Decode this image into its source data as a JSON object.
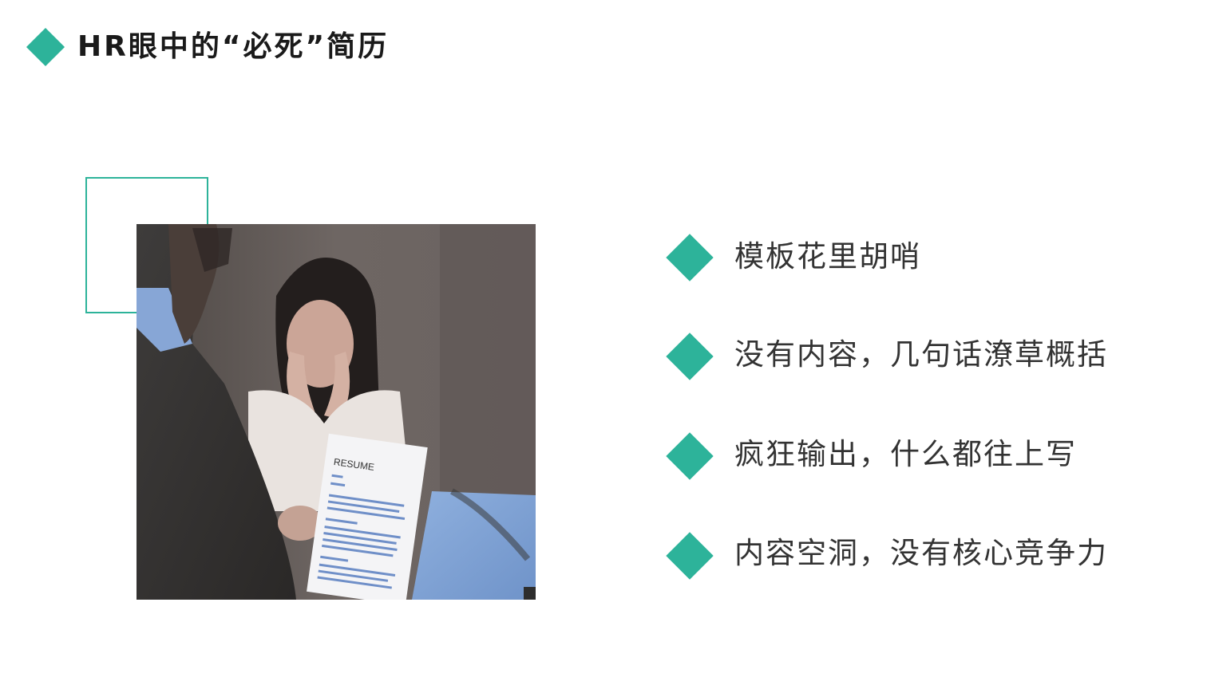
{
  "header": {
    "title": "HR眼中的“必死”简历"
  },
  "image": {
    "alt_description": "",
    "resume_label": "RESUME"
  },
  "bullets": [
    {
      "text": "模板花里胡哨"
    },
    {
      "text": "没有内容，几句话潦草概括"
    },
    {
      "text": "疯狂输出，什么都往上写"
    },
    {
      "text": "内容空洞，没有核心竞争力"
    }
  ],
  "colors": {
    "accent": "#2db39a",
    "title": "#1a1a1a",
    "body_text": "#333333"
  },
  "icons": {
    "title_marker": "diamond-icon",
    "bullet_marker": "diamond-icon"
  }
}
